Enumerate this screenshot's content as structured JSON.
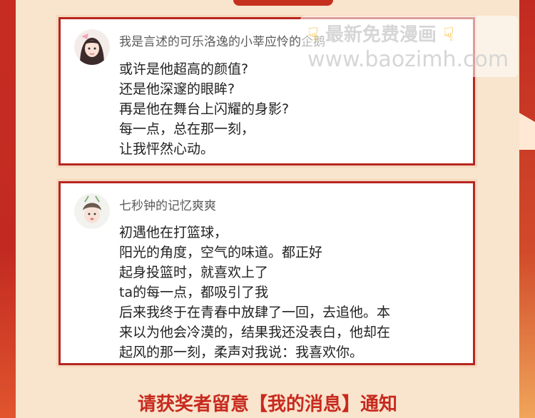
{
  "comments": [
    {
      "username": "我是言述的可乐洛逸的小莘应怜的企鹅",
      "lines": [
        "或许是他超高的颜值?",
        "还是他深邃的眼眸?",
        "再是他在舞台上闪耀的身影?",
        "每一点，总在那一刻，",
        "让我怦然心动。"
      ]
    },
    {
      "username": "七秒钟的记忆爽爽",
      "lines": [
        "初遇他在打篮球，",
        "阳光的角度，空气的味道。都正好",
        "起身投篮时，就喜欢上了",
        "ta的每一点，都吸引了我",
        "后来我终于在青春中放肆了一回，去追他。本",
        "来以为他会冷漠的，结果我还没表白，他却在",
        "起风的那一刻，柔声对我说：我喜欢你。"
      ]
    }
  ],
  "watermark": {
    "line1": "最新免费漫画",
    "line2": "www.baozimh.com"
  },
  "notice": "请获奖者留意【我的消息】通知",
  "colors": {
    "border": "#b7261f",
    "panel": "#f9e4cd",
    "accent": "#c72a1e"
  }
}
